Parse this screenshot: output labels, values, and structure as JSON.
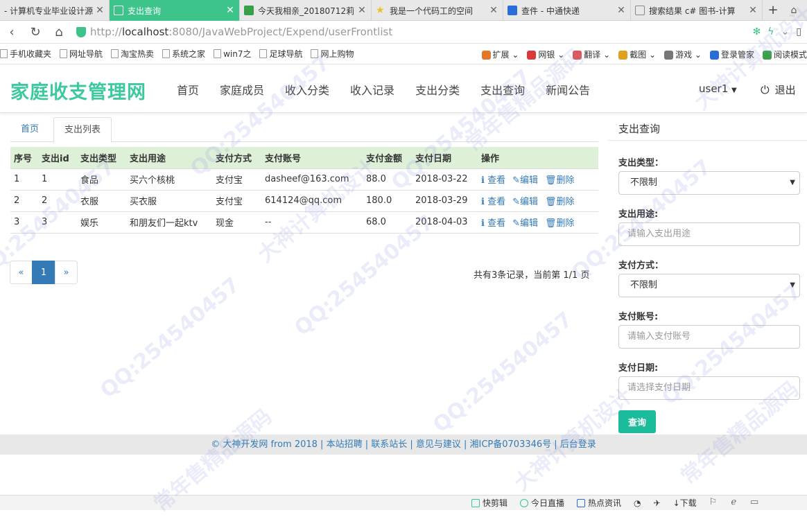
{
  "browser": {
    "tabs": [
      {
        "title": "- 计算机专业毕业设计源",
        "icon_color": "#f0a030",
        "active": false
      },
      {
        "title": "支出查询",
        "icon_color": "#ffffff",
        "active": true
      },
      {
        "title": "今天我相亲_20180712莉",
        "icon_color": "#3aa047",
        "active": false
      },
      {
        "title": "我是一个代码工的空间",
        "icon_color": "#f0c020",
        "active": false
      },
      {
        "title": "查件 - 中通快递",
        "icon_color": "#2b6dd8",
        "active": false
      },
      {
        "title": "搜索结果 c# 图书-计算",
        "icon_color": "#ffffff",
        "active": false
      }
    ],
    "url_prefix": "http://",
    "url_host": "localhost",
    "url_rest": ":8080/JavaWebProject/Expend/userFrontlist",
    "bookmarks": [
      "手机收藏夹",
      "网址导航",
      "淘宝热卖",
      "系统之家",
      "win7之",
      "足球导航",
      "网上购物"
    ],
    "bookmark_tools": [
      "扩展",
      "网银",
      "翻译",
      "截图",
      "游戏",
      "登录管家",
      "阅读模式"
    ]
  },
  "site": {
    "brand": "家庭收支管理网",
    "nav": [
      "首页",
      "家庭成员",
      "收入分类",
      "收入记录",
      "支出分类",
      "支出查询",
      "新闻公告"
    ],
    "user": "user1",
    "logout": "退出"
  },
  "breadcrumb_tabs": {
    "home": "首页",
    "list": "支出列表"
  },
  "table": {
    "headers": [
      "序号",
      "支出id",
      "支出类型",
      "支出用途",
      "支付方式",
      "支付账号",
      "支付金额",
      "支付日期",
      "操作"
    ],
    "rows": [
      {
        "seq": "1",
        "id": "1",
        "type": "食品",
        "purpose": "买六个核桃",
        "method": "支付宝",
        "account": "dasheef@163.com",
        "amount": "88.0",
        "date": "2018-03-22"
      },
      {
        "seq": "2",
        "id": "2",
        "type": "衣服",
        "purpose": "买衣服",
        "method": "支付宝",
        "account": "614124@qq.com",
        "amount": "180.0",
        "date": "2018-03-29"
      },
      {
        "seq": "3",
        "id": "3",
        "type": "娱乐",
        "purpose": "和朋友们一起ktv",
        "method": "现金",
        "account": "--",
        "amount": "68.0",
        "date": "2018-04-03"
      }
    ],
    "actions": {
      "view": "查看",
      "edit": "编辑",
      "delete": "删除"
    }
  },
  "pager": {
    "prev": "«",
    "current": "1",
    "next": "»",
    "info": "共有3条记录，当前第 1/1 页"
  },
  "query": {
    "title": "支出查询",
    "type_label": "支出类型：",
    "type_value": "不限制",
    "purpose_label": "支出用途:",
    "purpose_placeholder": "请输入支出用途",
    "method_label": "支付方式：",
    "method_value": "不限制",
    "account_label": "支付账号:",
    "account_placeholder": "请输入支付账号",
    "date_label": "支付日期:",
    "date_placeholder": "请选择支付日期",
    "submit": "查询"
  },
  "footer": "© 大神开发网 from 2018 | 本站招聘 | 联系站长 | 意见与建议 | 湘ICP备0703346号 | 后台登录",
  "statusbar": [
    "快剪辑",
    "今日直播",
    "热点资讯",
    "下载"
  ],
  "watermarks": [
    "QQ:254540457",
    "常年售精品源码",
    "大神计算机设计"
  ]
}
